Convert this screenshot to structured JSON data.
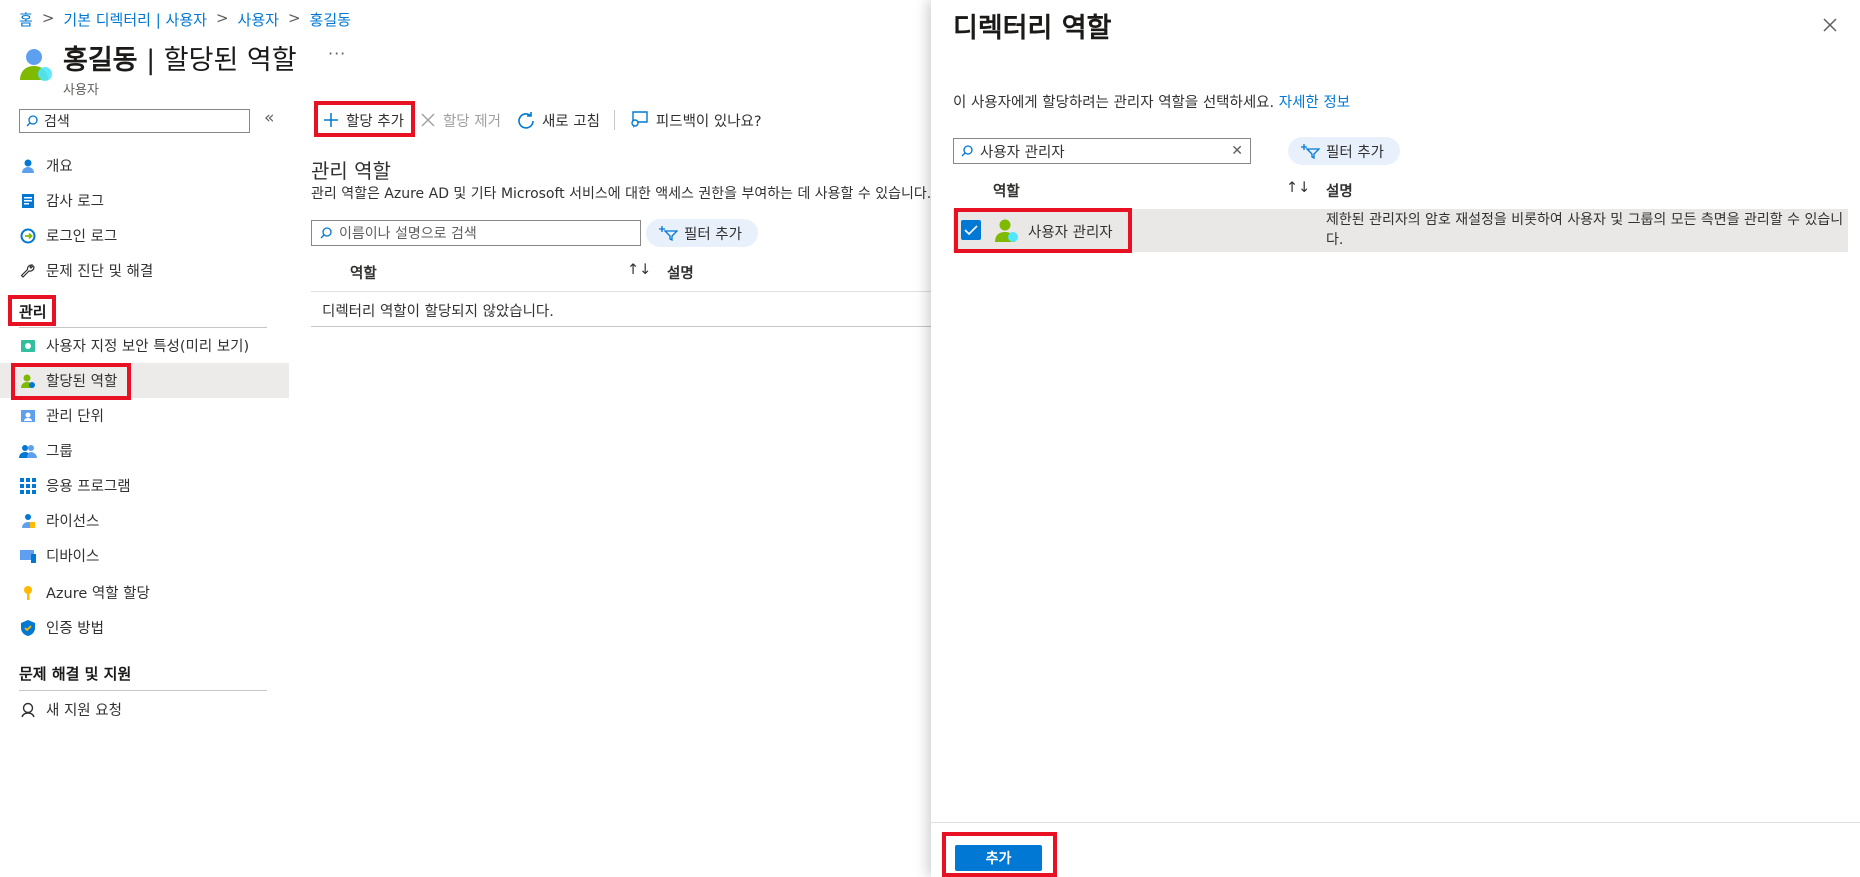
{
  "breadcrumb": [
    "홈",
    "기본 디렉터리 | 사용자",
    "사용자",
    "홍길동"
  ],
  "header": {
    "name": "홍길동",
    "separator": " | ",
    "page": "할당된 역할",
    "subtitle": "사용자",
    "more": "···"
  },
  "sidebar": {
    "search_placeholder": "검색",
    "collapse": "«",
    "items_top": [
      {
        "label": "개요",
        "icon": "person-icon"
      },
      {
        "label": "감사 로그",
        "icon": "audit-log-icon"
      },
      {
        "label": "로그인 로그",
        "icon": "sign-in-icon"
      },
      {
        "label": "문제 진단 및 해결",
        "icon": "wrench-icon"
      }
    ],
    "section_manage": "관리",
    "items_manage": [
      {
        "label": "사용자 지정 보안 특성(미리 보기)",
        "icon": "security-attribute-icon"
      },
      {
        "label": "할당된 역할",
        "icon": "assigned-roles-icon"
      },
      {
        "label": "관리 단위",
        "icon": "admin-unit-icon"
      },
      {
        "label": "그룹",
        "icon": "group-icon"
      },
      {
        "label": "응용 프로그램",
        "icon": "apps-grid-icon"
      },
      {
        "label": "라이선스",
        "icon": "license-icon"
      },
      {
        "label": "디바이스",
        "icon": "device-icon"
      },
      {
        "label": "Azure 역할 할당",
        "icon": "key-icon"
      },
      {
        "label": "인증 방법",
        "icon": "shield-icon"
      }
    ],
    "section_support": "문제 해결 및 지원",
    "items_support": [
      {
        "label": "새 지원 요청",
        "icon": "support-icon"
      }
    ]
  },
  "toolbar": {
    "add_assignment": "할당 추가",
    "remove_assignment": "할당 제거",
    "refresh": "새로 고침",
    "feedback": "피드백이 있나요?"
  },
  "main": {
    "title": "관리 역할",
    "description": "관리 역할은 Azure AD 및 기타 Microsoft 서비스에 대한 액세스 권한을 부여하는 데 사용할 수 있습니다.",
    "search_placeholder": "이름이나 설명으로 검색",
    "filter": "필터 추가",
    "col_role": "역할",
    "col_desc": "설명",
    "sort": "↑↓",
    "empty": "디렉터리 역할이 할당되지 않았습니다."
  },
  "panel": {
    "title": "디렉터리 역할",
    "info": "이 사용자에게 할당하려는 관리자 역할을 선택하세요. ",
    "info_link": "자세한 정보",
    "search_value": "사용자 관리자",
    "filter": "필터 추가",
    "col_role": "역할",
    "col_desc": "설명",
    "sort": "↑↓",
    "row": {
      "checked": true,
      "role": "사용자 관리자",
      "description": "제한된 관리자의 암호 재설정을 비롯하여 사용자 및 그룹의 모든 측면을 관리할 수 있습니다."
    },
    "add_button": "추가"
  },
  "colors": {
    "accent": "#0078d4",
    "highlight": "#e81123",
    "active_row": "#edebe9"
  }
}
